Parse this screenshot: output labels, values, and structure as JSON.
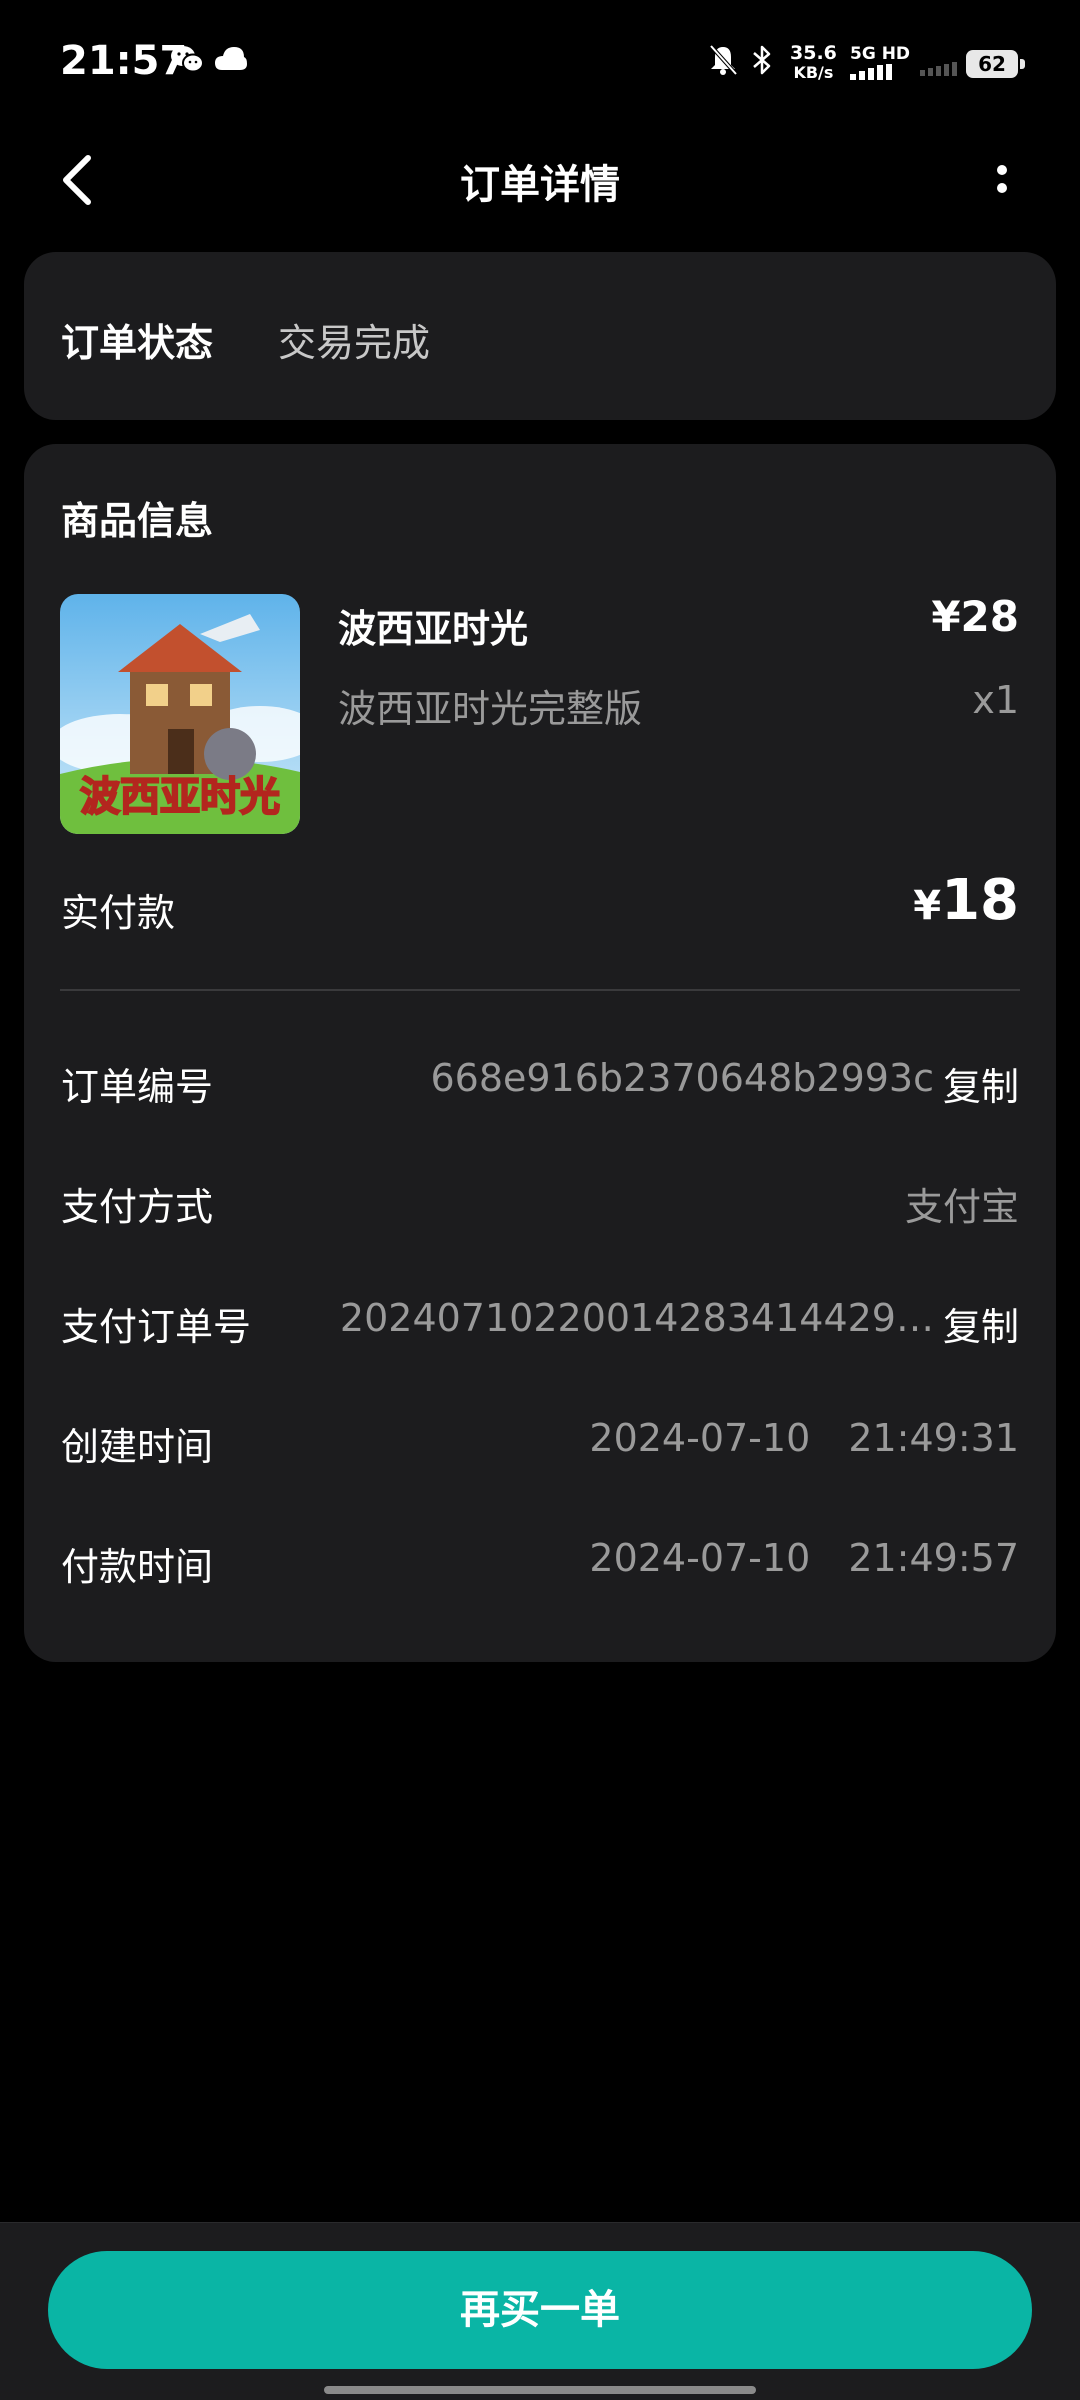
{
  "status_bar": {
    "time": "21:57",
    "net_speed_value": "35.6",
    "net_speed_unit": "KB/s",
    "network_type": "5G HD",
    "battery": "62",
    "icons": [
      "wechat-icon",
      "cloud-icon",
      "mute-bell-icon",
      "bluetooth-icon",
      "signal-icon",
      "battery-icon"
    ]
  },
  "header": {
    "title": "订单详情",
    "back_icon": "chevron-left-icon",
    "more_icon": "more-vertical-icon"
  },
  "order_status": {
    "label": "订单状态",
    "value": "交易完成"
  },
  "product_section": {
    "title": "商品信息",
    "product": {
      "name": "波西亚时光",
      "price": "¥28",
      "description": "波西亚时光完整版",
      "quantity": "x1",
      "thumbnail_text": "波西亚时光"
    },
    "paid": {
      "label": "实付款",
      "currency": "¥",
      "amount": "18"
    }
  },
  "details": {
    "order_no": {
      "label": "订单编号",
      "value": "668e916b2370648b2993c",
      "action": "复制"
    },
    "pay_method": {
      "label": "支付方式",
      "value": "支付宝"
    },
    "pay_order_no": {
      "label": "支付订单号",
      "value": "20240710220014283414429…",
      "action": "复制"
    },
    "created": {
      "label": "创建时间",
      "value": "2024-07-10 21:49:31"
    },
    "paid_time": {
      "label": "付款时间",
      "value": "2024-07-10 21:49:57"
    }
  },
  "footer": {
    "buy_again": "再买一单"
  },
  "colors": {
    "background": "#000000",
    "card": "#1c1c1e",
    "accent": "#0ab5a5",
    "secondary_text": "#9a9a9a"
  }
}
